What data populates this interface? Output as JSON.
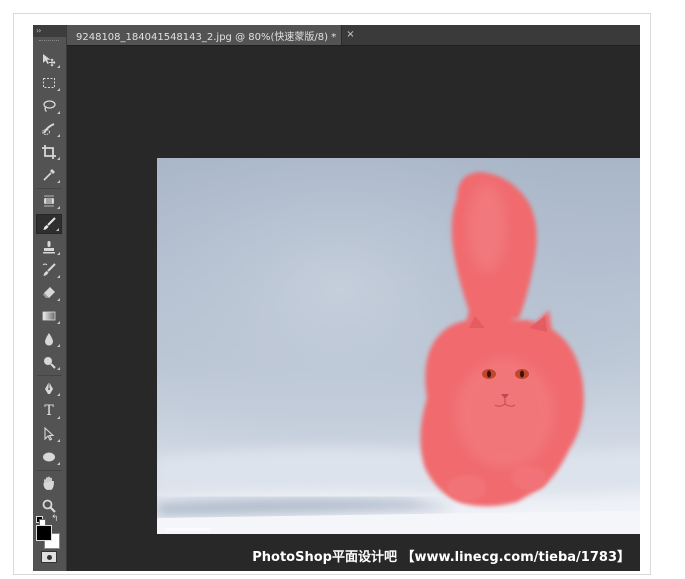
{
  "document_tab": {
    "title": "9248108_184041548143_2.jpg @ 80%(快速蒙版/8) *",
    "close_glyph": "×"
  },
  "toolbar": {
    "grip_glyph": "››",
    "tools": [
      {
        "name": "move-tool",
        "icon": "move-icon"
      },
      {
        "name": "marquee-tool",
        "icon": "rect-marquee-icon"
      },
      {
        "name": "lasso-tool",
        "icon": "lasso-icon"
      },
      {
        "name": "quick-selection-tool",
        "icon": "quick-select-icon"
      },
      {
        "name": "crop-tool",
        "icon": "crop-icon"
      },
      {
        "name": "eyedropper-tool",
        "icon": "eyedropper-icon"
      },
      {
        "name": "healing-brush-tool",
        "icon": "bandage-icon"
      },
      {
        "name": "brush-tool",
        "icon": "brush-icon",
        "active": true
      },
      {
        "name": "clone-stamp-tool",
        "icon": "stamp-icon"
      },
      {
        "name": "history-brush-tool",
        "icon": "history-brush-icon"
      },
      {
        "name": "eraser-tool",
        "icon": "eraser-icon"
      },
      {
        "name": "gradient-tool",
        "icon": "gradient-icon"
      },
      {
        "name": "blur-tool",
        "icon": "drop-icon"
      },
      {
        "name": "dodge-tool",
        "icon": "dodge-icon"
      },
      {
        "name": "pen-tool",
        "icon": "pen-icon"
      },
      {
        "name": "type-tool",
        "icon": "type-icon",
        "glyph": "T"
      },
      {
        "name": "path-selection-tool",
        "icon": "path-select-icon"
      },
      {
        "name": "ellipse-tool",
        "icon": "ellipse-icon"
      },
      {
        "name": "hand-tool",
        "icon": "hand-icon"
      },
      {
        "name": "zoom-tool",
        "icon": "zoom-icon"
      }
    ],
    "foreground_color": "#000000",
    "background_color": "#ffffff"
  },
  "colors": {
    "quick_mask_overlay": "#ff6464",
    "workspace": "#282828",
    "toolbar": "#535353"
  },
  "watermark": "PhotoShop平面设计吧 【www.linecg.com/tieba/1783】"
}
